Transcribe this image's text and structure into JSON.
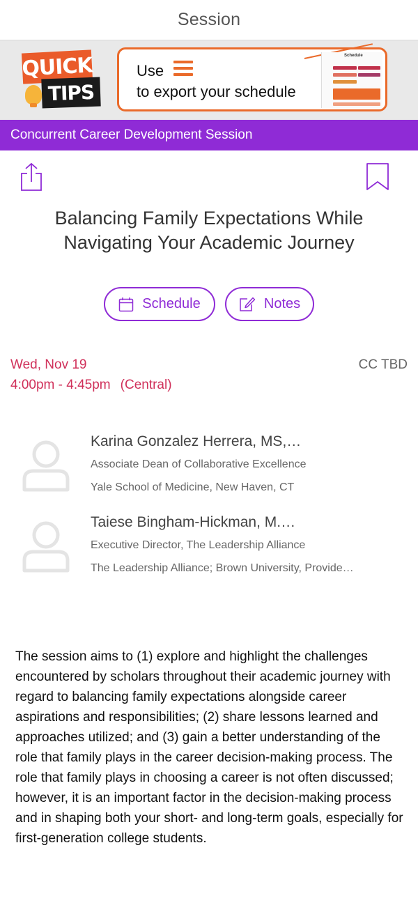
{
  "header": {
    "title": "Session"
  },
  "banner": {
    "quick": "QUICK",
    "tips": "TIPS",
    "use_text": "Use",
    "export_text": "to export your schedule",
    "mini_title": "Schedule",
    "accent": "#ea6a2a"
  },
  "category": {
    "label": "Concurrent Career Development Session",
    "color": "#8f2bd6"
  },
  "actions": {
    "share_icon": "share-icon",
    "bookmark_icon": "bookmark-icon"
  },
  "session": {
    "title": "Balancing Family Expectations While Navigating Your Academic Journey",
    "schedule_label": "Schedule",
    "notes_label": "Notes",
    "date": "Wed, Nov 19",
    "time": "4:00pm - 4:45pm",
    "timezone": "(Central)",
    "location": "CC TBD",
    "date_color": "#d0305a"
  },
  "speakers": [
    {
      "name": "Karina Gonzalez Herrera, MS,…",
      "role": "Associate Dean of Collaborative Excellence",
      "org": "Yale School of Medicine, New Haven, CT"
    },
    {
      "name": "Taiese Bingham-Hickman, M.…",
      "role": "Executive Director, The Leadership Alliance",
      "org": "The Leadership Alliance; Brown University, Provide…"
    }
  ],
  "description": "The session aims to (1) explore and highlight the challenges encountered by scholars throughout their academic journey with regard to balancing family expectations alongside career aspirations and responsibilities; (2) share lessons learned and approaches utilized; and (3) gain a better understanding of the role that family plays in the career decision-making process. The role that family plays in choosing a career is not often discussed; however, it is an important factor in the decision-making process and in shaping both your short- and long-term goals, especially for first-generation college students."
}
